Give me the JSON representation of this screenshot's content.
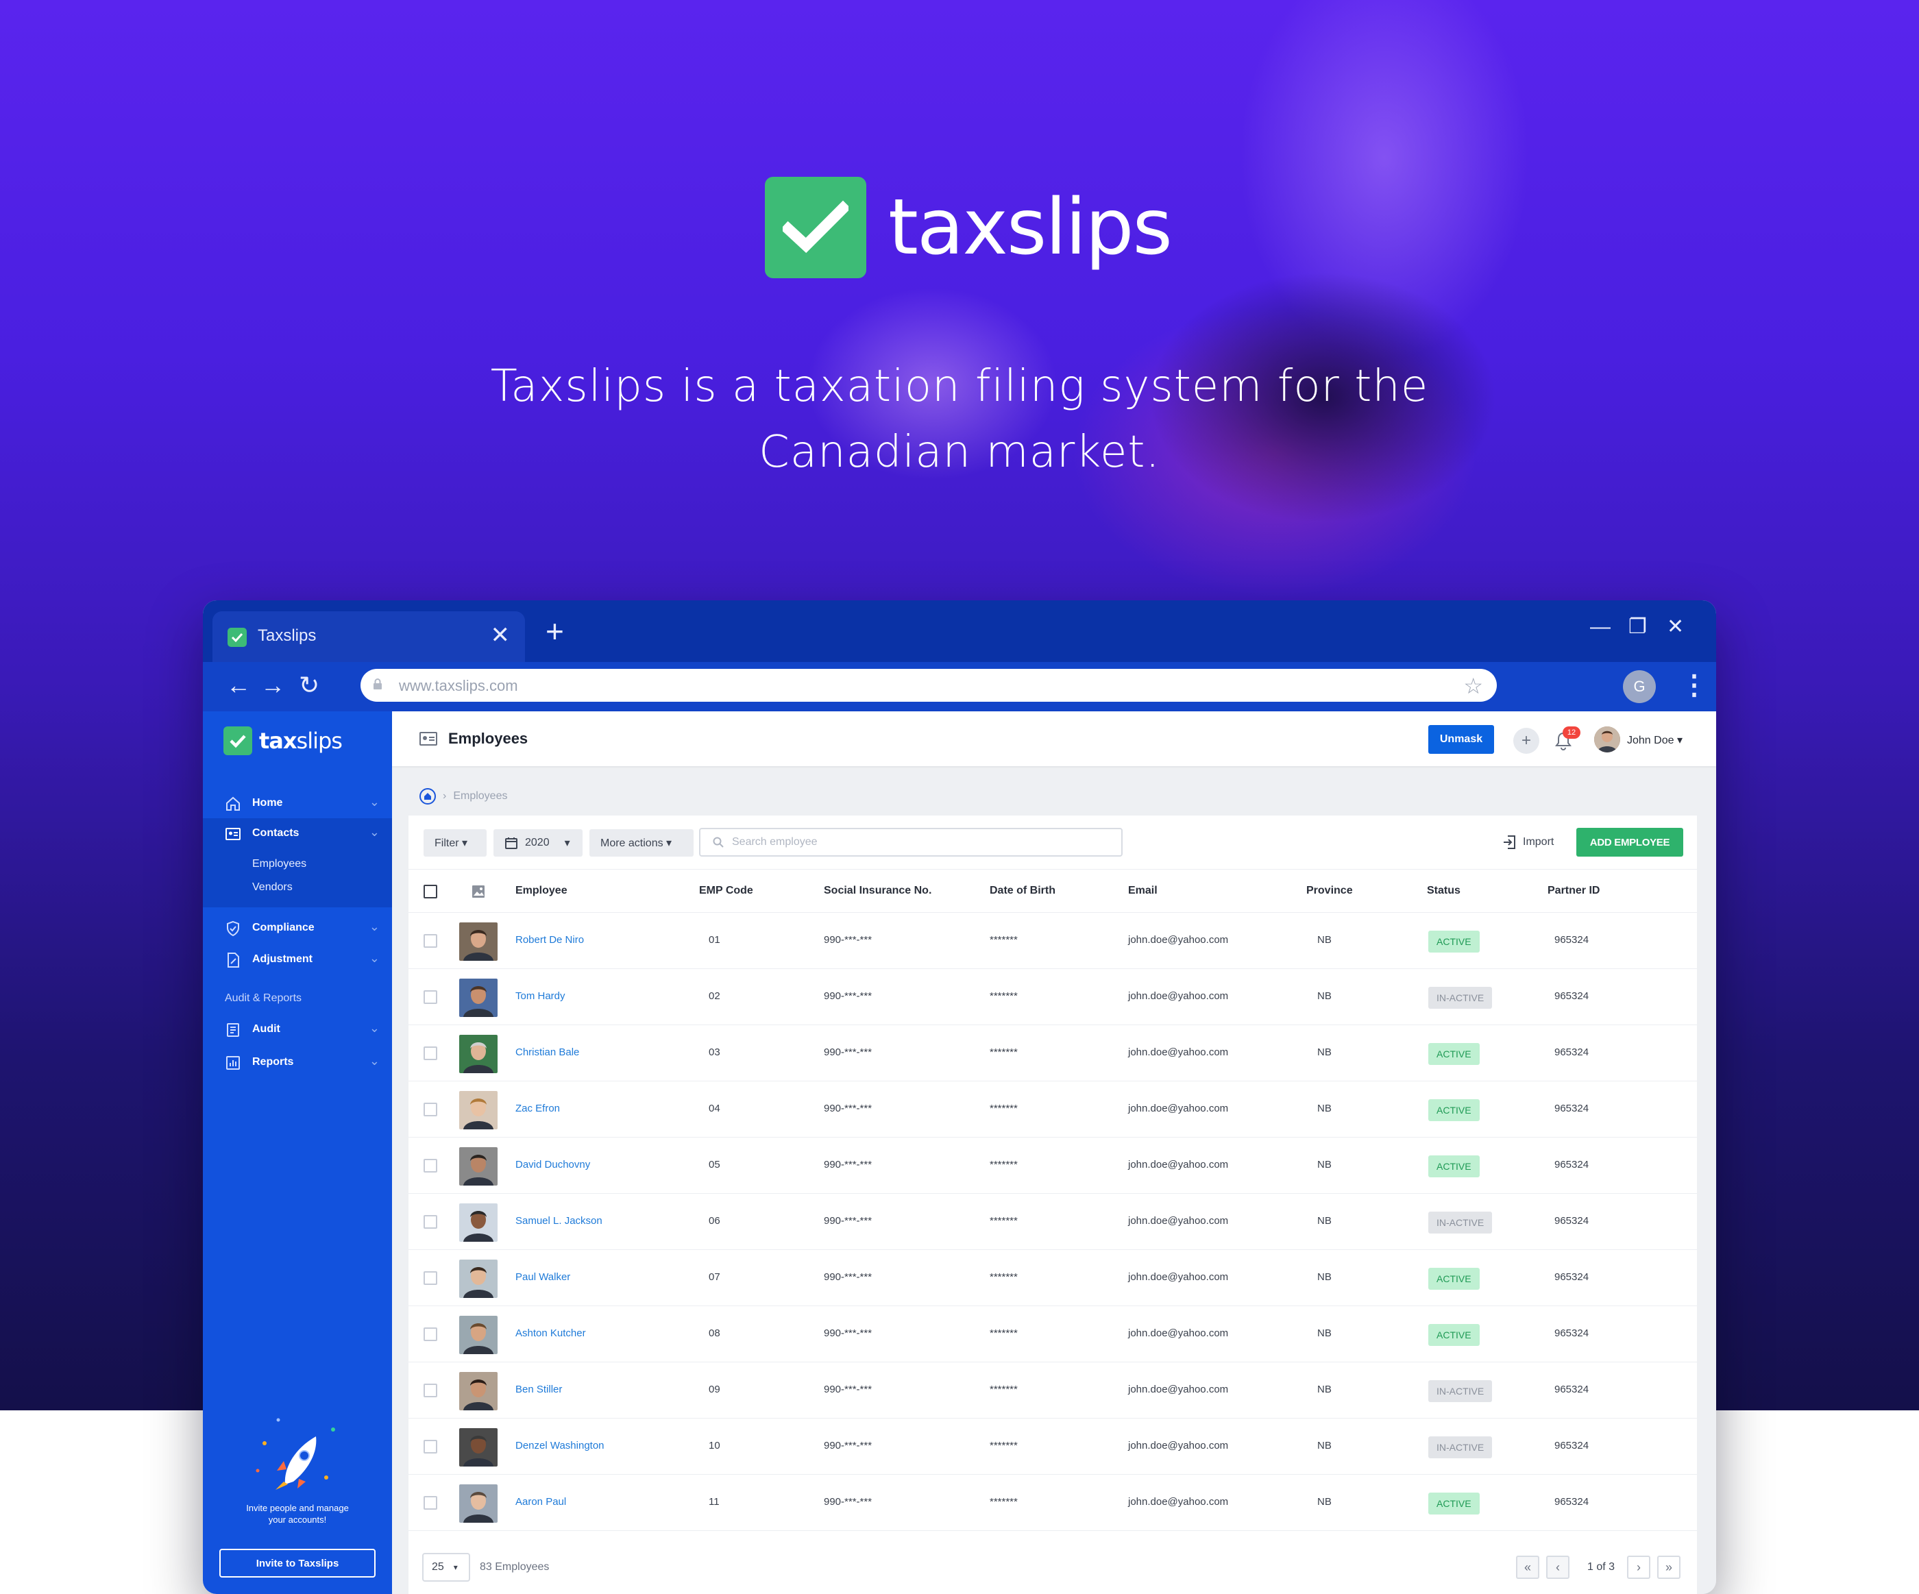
{
  "hero": {
    "brand": "taxslips",
    "tagline_line1": "Taxslips is a taxation filing system for the",
    "tagline_line2": "Canadian market."
  },
  "colors": {
    "brand_green": "#3dbb76",
    "sidebar_blue": "#1252dd",
    "primary_button": "#0b63e0",
    "add_button": "#2eb26c",
    "active_badge": "#bff0d2",
    "inactive_badge": "#e2e4e8",
    "notification_red": "#f2453d"
  },
  "browser": {
    "tab_title": "Taxslips",
    "tab_close": "✕",
    "new_tab": "+",
    "minimize": "—",
    "restore": "❐",
    "close": "✕",
    "back": "←",
    "forward": "→",
    "reload": "↻",
    "url": "www.taxslips.com",
    "star": "☆",
    "profile_initial": "G",
    "menu": "⋮"
  },
  "sidebar": {
    "brand_bold": "tax",
    "brand_rest": "slips",
    "items": [
      {
        "label": "Home",
        "icon": "home-icon"
      },
      {
        "label": "Contacts",
        "icon": "contacts-icon"
      },
      {
        "label": "Compliance",
        "icon": "shield-icon"
      },
      {
        "label": "Adjustment",
        "icon": "adjustment-icon"
      }
    ],
    "contacts_sub": [
      "Employees",
      "Vendors"
    ],
    "section": "Audit & Reports",
    "section_items": [
      {
        "label": "Audit",
        "icon": "audit-icon"
      },
      {
        "label": "Reports",
        "icon": "reports-icon"
      }
    ],
    "chevron": "⌄",
    "invite_text_1": "Invite people and manage",
    "invite_text_2": "your accounts!",
    "invite_button": "Invite to Taxslips"
  },
  "topbar": {
    "title": "Employees",
    "unmask": "Unmask",
    "plus": "+",
    "notifications": "12",
    "user": "John Doe ▾"
  },
  "breadcrumb": {
    "sep": "›",
    "current": "Employees"
  },
  "toolbar": {
    "filter": "Filter ▾",
    "year": "2020",
    "year_caret": "▾",
    "more_actions": "More actions ▾",
    "search_placeholder": "Search employee",
    "import": "Import",
    "add_employee": "ADD EMPLOYEE"
  },
  "table": {
    "columns": [
      "Employee",
      "EMP Code",
      "Social Insurance No.",
      "Date of Birth",
      "Email",
      "Province",
      "Status",
      "Partner ID"
    ],
    "rows": [
      {
        "name": "Robert De Niro",
        "code": "01",
        "sin": "990-***-***",
        "dob": "*******",
        "email": "john.doe@yahoo.com",
        "province": "NB",
        "status": "ACTIVE",
        "partner": "965324"
      },
      {
        "name": "Tom Hardy",
        "code": "02",
        "sin": "990-***-***",
        "dob": "*******",
        "email": "john.doe@yahoo.com",
        "province": "NB",
        "status": "IN-ACTIVE",
        "partner": "965324"
      },
      {
        "name": "Christian Bale",
        "code": "03",
        "sin": "990-***-***",
        "dob": "*******",
        "email": "john.doe@yahoo.com",
        "province": "NB",
        "status": "ACTIVE",
        "partner": "965324"
      },
      {
        "name": "Zac Efron",
        "code": "04",
        "sin": "990-***-***",
        "dob": "*******",
        "email": "john.doe@yahoo.com",
        "province": "NB",
        "status": "ACTIVE",
        "partner": "965324"
      },
      {
        "name": "David Duchovny",
        "code": "05",
        "sin": "990-***-***",
        "dob": "*******",
        "email": "john.doe@yahoo.com",
        "province": "NB",
        "status": "ACTIVE",
        "partner": "965324"
      },
      {
        "name": "Samuel L. Jackson",
        "code": "06",
        "sin": "990-***-***",
        "dob": "*******",
        "email": "john.doe@yahoo.com",
        "province": "NB",
        "status": "IN-ACTIVE",
        "partner": "965324"
      },
      {
        "name": "Paul Walker",
        "code": "07",
        "sin": "990-***-***",
        "dob": "*******",
        "email": "john.doe@yahoo.com",
        "province": "NB",
        "status": "ACTIVE",
        "partner": "965324"
      },
      {
        "name": "Ashton Kutcher",
        "code": "08",
        "sin": "990-***-***",
        "dob": "*******",
        "email": "john.doe@yahoo.com",
        "province": "NB",
        "status": "ACTIVE",
        "partner": "965324"
      },
      {
        "name": "Ben Stiller",
        "code": "09",
        "sin": "990-***-***",
        "dob": "*******",
        "email": "john.doe@yahoo.com",
        "province": "NB",
        "status": "IN-ACTIVE",
        "partner": "965324"
      },
      {
        "name": "Denzel Washington",
        "code": "10",
        "sin": "990-***-***",
        "dob": "*******",
        "email": "john.doe@yahoo.com",
        "province": "NB",
        "status": "IN-ACTIVE",
        "partner": "965324"
      },
      {
        "name": "Aaron Paul",
        "code": "11",
        "sin": "990-***-***",
        "dob": "*******",
        "email": "john.doe@yahoo.com",
        "province": "NB",
        "status": "ACTIVE",
        "partner": "965324"
      }
    ]
  },
  "pagination": {
    "per_page": "25",
    "per_page_caret": "▾",
    "total": "83 Employees",
    "first": "«",
    "prev": "‹",
    "page_label": "1 of 3",
    "next": "›",
    "last": "»"
  }
}
